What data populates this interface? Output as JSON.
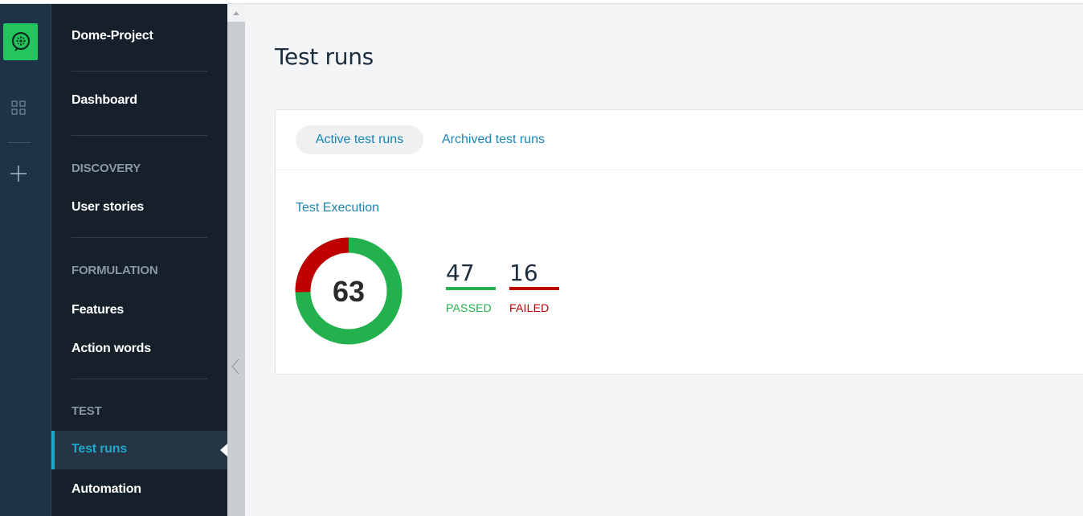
{
  "colors": {
    "rail": "#1d3346",
    "nav": "#15202b",
    "accent": "#1fa7c9",
    "link": "#1a86b5",
    "passed": "#22b14c",
    "failed": "#c00000",
    "logo": "#22c55e"
  },
  "rail": {
    "logo_icon": "cucumber-logo-icon",
    "grid_icon": "apps-grid-icon",
    "plus_icon": "plus-icon"
  },
  "nav": {
    "project": "Dome-Project",
    "dashboard": "Dashboard",
    "discovery_section": "DISCOVERY",
    "user_stories": "User stories",
    "formulation_section": "FORMULATION",
    "features": "Features",
    "action_words": "Action words",
    "test_section": "TEST",
    "test_runs": "Test runs",
    "automation": "Automation"
  },
  "main": {
    "title": "Test runs",
    "tabs": [
      {
        "label": "Active test runs",
        "active": true
      },
      {
        "label": "Archived test runs",
        "active": false
      }
    ],
    "execution": {
      "title": "Test Execution",
      "total": "63",
      "passed": {
        "count": 47,
        "label": "PASSED"
      },
      "failed": {
        "count": 16,
        "label": "FAILED"
      }
    }
  }
}
